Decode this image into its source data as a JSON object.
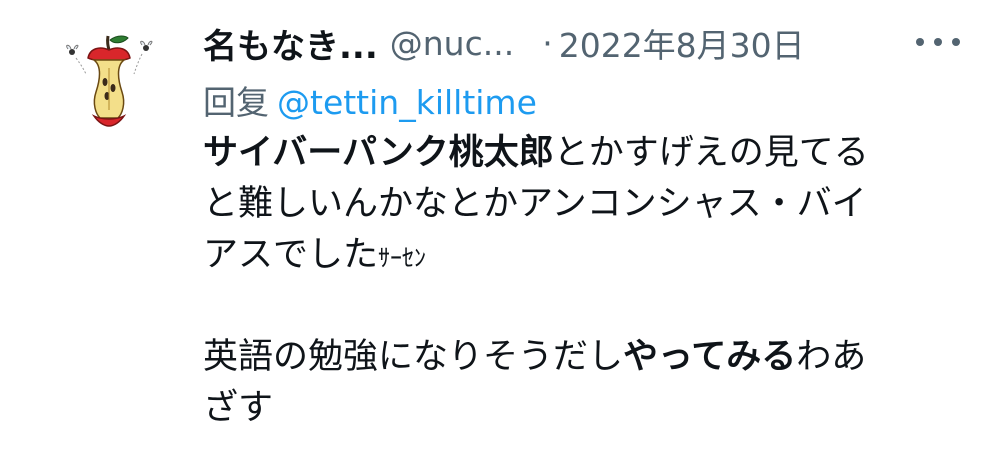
{
  "tweet": {
    "display_name": "名もなき...",
    "handle": "@nuc...",
    "separator": "·",
    "date": "2022年8月30日",
    "more_icon": "more-horizontal-icon",
    "avatar_icon": "apple-core-avatar",
    "reply_prefix": "回复",
    "reply_mention": "@tettin_killtime",
    "body": {
      "line1_bold": "サイバーパンク桃太郎",
      "line1_rest": "とかすげえの見てる",
      "line2": "と難しいんかなとかアンコンシャス・バイ",
      "line3_main": "アスでした",
      "line3_small": "ｻｰｾﾝ",
      "line4_pre": "英語の勉強になりそうだし",
      "line4_bold": "やってみる",
      "line4_post": "わあ",
      "line5": "ざす"
    }
  },
  "colors": {
    "text": "#0f1419",
    "muted": "#536471",
    "link": "#1d9bf0",
    "avatar_red": "#d9262b",
    "avatar_core": "#f3df8a"
  }
}
